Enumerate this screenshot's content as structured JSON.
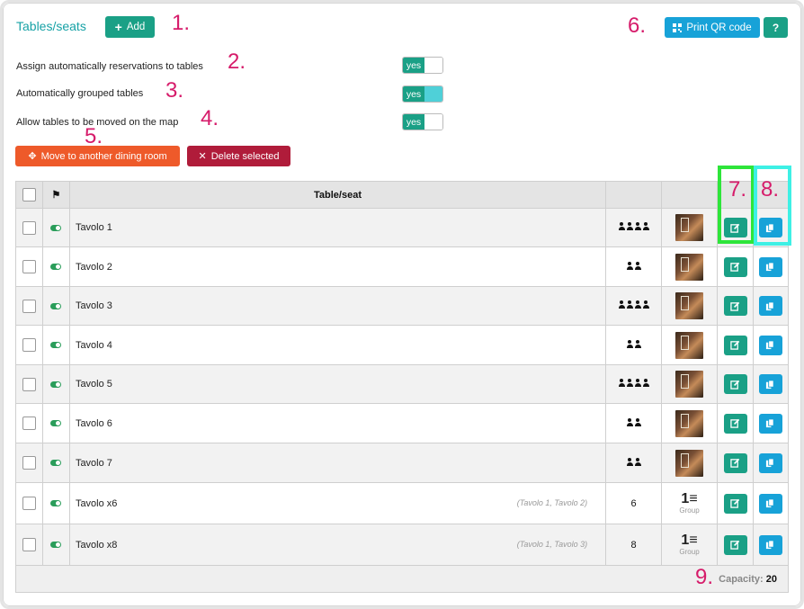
{
  "header": {
    "title": "Tables/seats",
    "add_label": "Add",
    "print_qr_label": "Print QR code",
    "help_label": "?"
  },
  "settings": [
    {
      "label": "Assign automatically reservations to tables",
      "toggle": "yes"
    },
    {
      "label": "Automatically grouped tables",
      "toggle": "yes"
    },
    {
      "label": "Allow tables to be moved on the map",
      "toggle": "yes"
    }
  ],
  "actions": {
    "move_label": "Move to another dining room",
    "delete_label": "Delete selected"
  },
  "annotations": [
    "1.",
    "2.",
    "3.",
    "4.",
    "5.",
    "6.",
    "7.",
    "8.",
    "9."
  ],
  "table": {
    "header": {
      "name": "Table/seat"
    },
    "rows": [
      {
        "name": "Tavolo 1",
        "group_of": "",
        "seats": 4,
        "seats_text": "",
        "media": "photo"
      },
      {
        "name": "Tavolo 2",
        "group_of": "",
        "seats": 2,
        "seats_text": "",
        "media": "photo"
      },
      {
        "name": "Tavolo 3",
        "group_of": "",
        "seats": 4,
        "seats_text": "",
        "media": "photo"
      },
      {
        "name": "Tavolo 4",
        "group_of": "",
        "seats": 2,
        "seats_text": "",
        "media": "photo"
      },
      {
        "name": "Tavolo 5",
        "group_of": "",
        "seats": 4,
        "seats_text": "",
        "media": "photo"
      },
      {
        "name": "Tavolo 6",
        "group_of": "",
        "seats": 2,
        "seats_text": "",
        "media": "photo"
      },
      {
        "name": "Tavolo 7",
        "group_of": "",
        "seats": 2,
        "seats_text": "",
        "media": "photo"
      },
      {
        "name": "Tavolo x6",
        "group_of": "(Tavolo 1, Tavolo 2)",
        "seats": 6,
        "seats_text": "6",
        "media": "group"
      },
      {
        "name": "Tavolo x8",
        "group_of": "(Tavolo 1, Tavolo 3)",
        "seats": 8,
        "seats_text": "8",
        "media": "group"
      }
    ],
    "group_glyph": "1≡",
    "group_label": "Group",
    "footer": {
      "capacity_label": "Capacity:",
      "capacity_value": "20"
    }
  },
  "colors": {
    "teal": "#1aa086",
    "blue": "#17a2d8",
    "orange": "#ee5a2a",
    "crimson": "#b01c3a",
    "annotation": "#d61b6a"
  }
}
